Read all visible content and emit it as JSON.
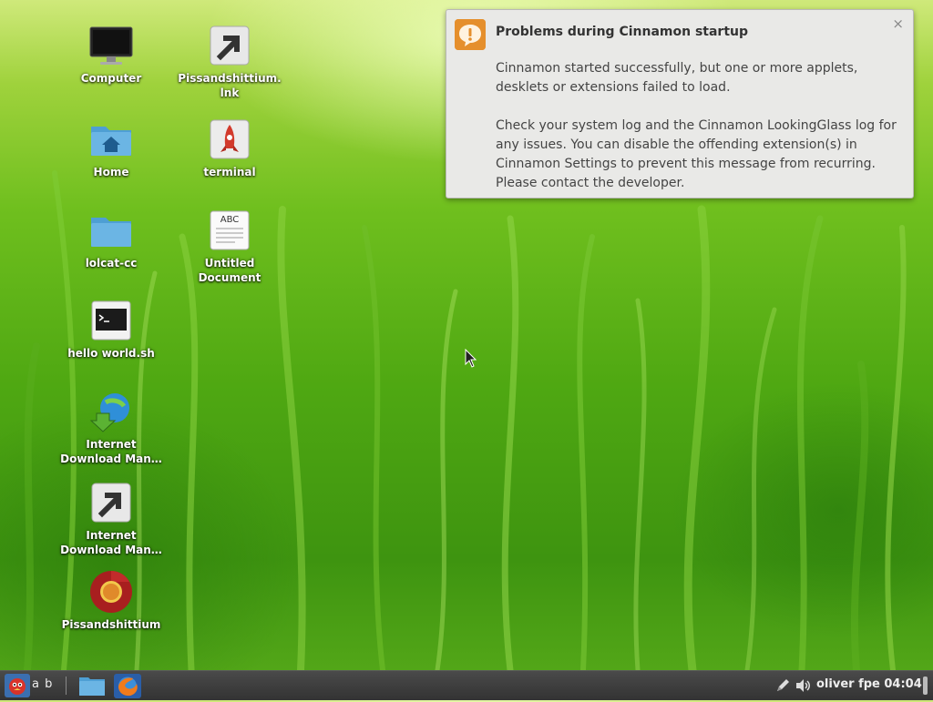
{
  "desktop": {
    "icons": [
      {
        "label": "Computer",
        "icon": "monitor-icon"
      },
      {
        "label": "Pissandshittium.\nlnk",
        "icon": "shortcut-icon"
      },
      {
        "label": "Home",
        "icon": "home-folder-icon"
      },
      {
        "label": "terminal",
        "icon": "rocket-icon"
      },
      {
        "label": "lolcat-cc",
        "icon": "folder-icon"
      },
      {
        "label": "Untitled\nDocument",
        "icon": "text-document-icon"
      },
      {
        "label": "hello world.sh",
        "icon": "shell-script-icon"
      },
      {
        "label": "Internet\nDownload Man…",
        "icon": "download-manager-icon"
      },
      {
        "label": "Internet\nDownload Man…",
        "icon": "shortcut-icon"
      },
      {
        "label": "Pissandshittium",
        "icon": "chromium-icon"
      }
    ]
  },
  "notification": {
    "title": "Problems during Cinnamon startup",
    "close": "×",
    "paragraph1": "Cinnamon started successfully, but one or more applets, desklets or extensions failed to load.",
    "paragraph2": "Check your system log and the Cinnamon LookingGlass log for any issues.  You can disable the offending extension(s) in Cinnamon Settings to prevent this message from recurring. Please contact the developer.",
    "icon": "warning-speech-icon",
    "accent": "#e58f2c"
  },
  "taskbar": {
    "workspace_label": "a b",
    "clock": "oliver fpe 04:04",
    "menu_icon": "cinnamon-menu-icon",
    "launchers": [
      "files-icon",
      "firefox-icon"
    ],
    "tray": [
      "pen-icon",
      "volume-icon"
    ]
  }
}
